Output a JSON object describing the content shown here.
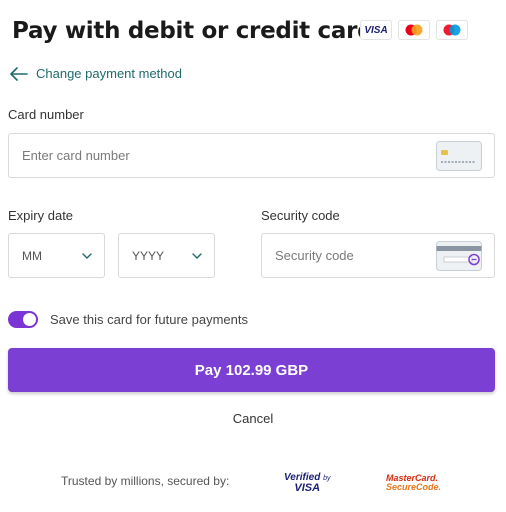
{
  "header": {
    "title": "Pay with debit or credit card",
    "brands": [
      {
        "name": "VISA",
        "icon": "visa-logo"
      },
      {
        "name": "Mastercard",
        "icon": "mastercard-logo",
        "colors": [
          "#eb001b",
          "#f79e1b"
        ]
      },
      {
        "name": "Maestro",
        "icon": "maestro-logo",
        "colors": [
          "#ed1c2e",
          "#0099df"
        ]
      }
    ]
  },
  "nav": {
    "back_label": "Change payment method",
    "back_icon": "arrow-left-icon",
    "accent": "#1f6b6b"
  },
  "card_number": {
    "label": "Card number",
    "placeholder": "Enter card number",
    "icon": "credit-card-front-icon"
  },
  "expiry": {
    "label": "Expiry date",
    "month_value": "MM",
    "year_value": "YYYY",
    "icon": "chevron-down-icon"
  },
  "security": {
    "label": "Security code",
    "placeholder": "Security code",
    "icon": "credit-card-back-cvv-icon"
  },
  "save_card": {
    "label": "Save this card for future payments",
    "checked": true
  },
  "pay_button": {
    "label": "Pay 102.99 GBP",
    "color": "#7b3fd3"
  },
  "cancel_label": "Cancel",
  "footer": {
    "trusted_text": "Trusted by millions, secured by:",
    "verified_by_visa": {
      "line1": "Verified",
      "by": "by",
      "line2": "VISA"
    },
    "mastercard_securecode": {
      "line1": "MasterCard.",
      "line2": "SecureCode."
    }
  }
}
